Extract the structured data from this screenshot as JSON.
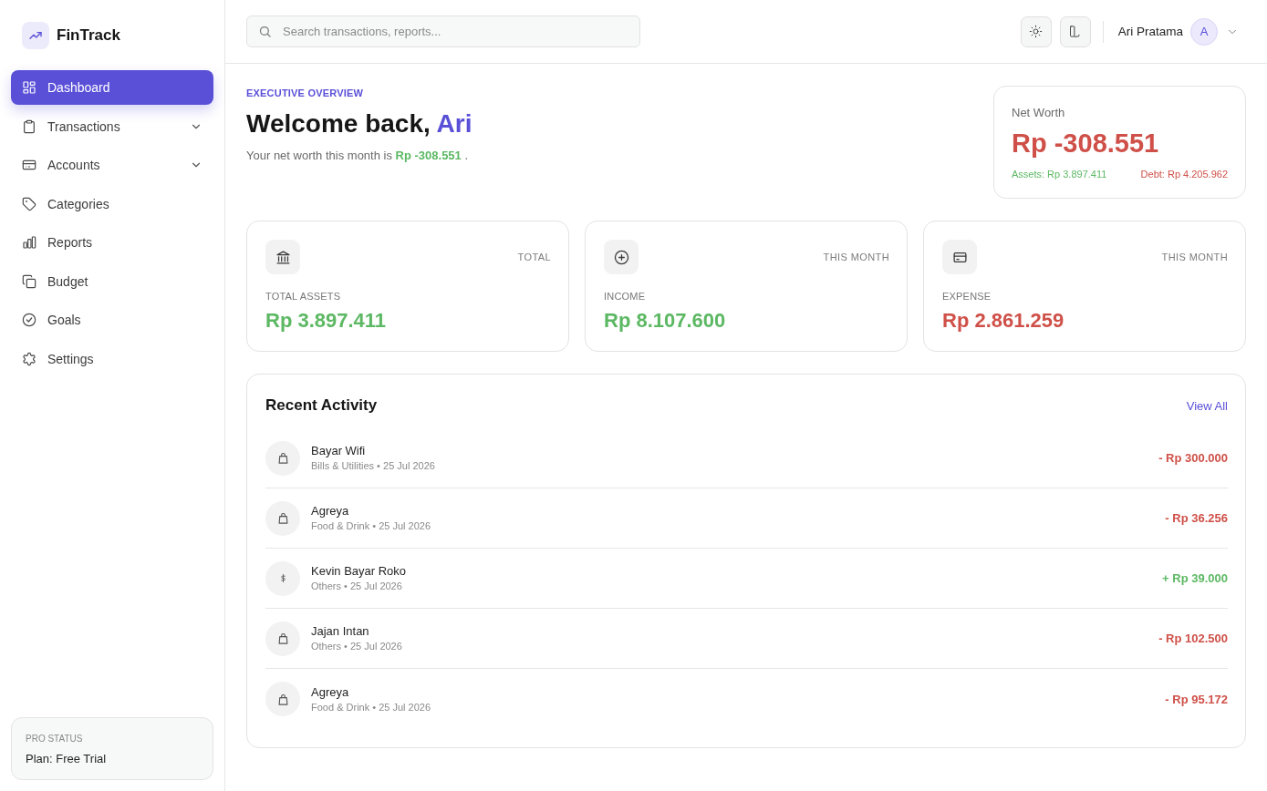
{
  "brand": {
    "name": "FinTrack"
  },
  "sidebar": {
    "items": [
      {
        "label": "Dashboard",
        "selected": true
      },
      {
        "label": "Transactions",
        "selected": false,
        "expanded": false
      },
      {
        "label": "Accounts",
        "selected": false,
        "expanded": false
      },
      {
        "label": "Categories",
        "selected": false
      },
      {
        "label": "Reports",
        "selected": false
      },
      {
        "label": "Budget",
        "selected": false
      },
      {
        "label": "Goals",
        "selected": false
      },
      {
        "label": "Settings",
        "selected": false
      }
    ],
    "plan_card": {
      "heading": "PRO STATUS",
      "plan": "Plan: Free Trial"
    }
  },
  "topbar": {
    "search": {
      "placeholder": "Search transactions, reports..."
    },
    "user": {
      "name": "Ari Pratama",
      "initial": "A"
    }
  },
  "overview": {
    "eyebrow": "EXECUTIVE OVERVIEW",
    "greeting": "Welcome back,",
    "user_name": "Ari",
    "summary": {
      "text": "Your net worth this month is",
      "value": "Rp -308.551",
      "positive": true,
      "end": "."
    }
  },
  "net_worth": {
    "label": "Net Worth",
    "value": "Rp -308.551",
    "positive": false,
    "assets": {
      "text": "Assets: Rp 3.897.411",
      "positive": true
    },
    "debt": {
      "text": "Debt: Rp 4.205.962",
      "positive": false
    }
  },
  "stats": [
    {
      "kind": "assets",
      "period": "TOTAL",
      "label": "TOTAL ASSETS",
      "value": "Rp 3.897.411",
      "positive": true
    },
    {
      "kind": "income",
      "period": "THIS MONTH",
      "label": "INCOME",
      "value": "Rp 8.107.600",
      "positive": true
    },
    {
      "kind": "expense",
      "period": "THIS MONTH",
      "label": "EXPENSE",
      "value": "Rp 2.861.259",
      "positive": false
    }
  ],
  "recent_activity": {
    "title": "Recent Activity",
    "link": "View All",
    "transactions": [
      {
        "kind": "expense",
        "name": "Bayar Wifi",
        "meta": "Bills & Utilities • 25 Jul 2026",
        "amount": "- Rp 300.000"
      },
      {
        "kind": "expense",
        "name": "Agreya",
        "meta": "Food & Drink • 25 Jul 2026",
        "amount": "- Rp 36.256"
      },
      {
        "kind": "income",
        "name": "Kevin Bayar Roko",
        "meta": "Others • 25 Jul 2026",
        "amount": "+ Rp 39.000"
      },
      {
        "kind": "expense",
        "name": "Jajan Intan",
        "meta": "Others • 25 Jul 2026",
        "amount": "- Rp 102.500"
      },
      {
        "kind": "expense",
        "name": "Agreya",
        "meta": "Food & Drink • 25 Jul 2026",
        "amount": "- Rp 95.172"
      }
    ]
  }
}
